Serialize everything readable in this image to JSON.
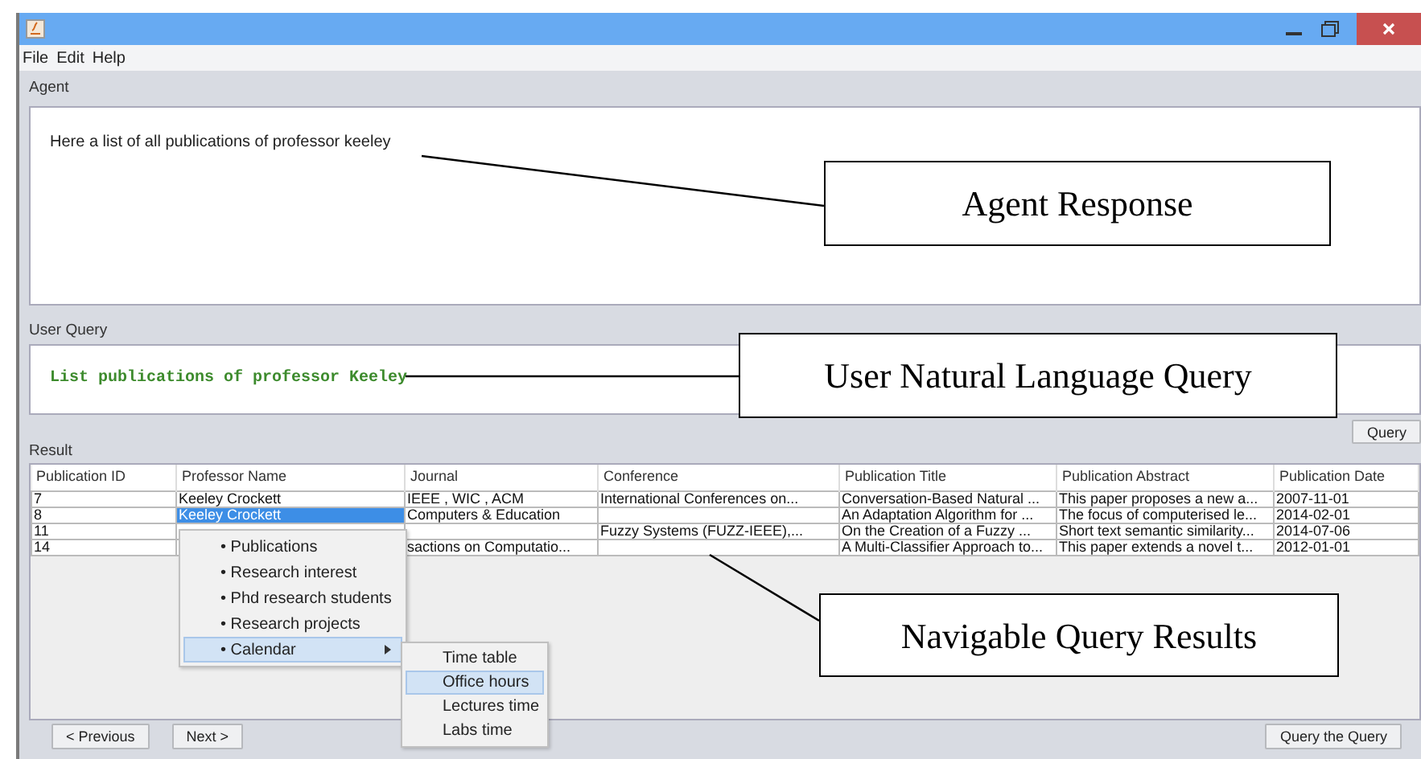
{
  "menu_bar": [
    "File",
    "Edit",
    "Help"
  ],
  "agent": {
    "label": "Agent",
    "text": "Here a list of all publications of professor keeley"
  },
  "user_query": {
    "label": "User Query",
    "text": "List publications of professor Keeley"
  },
  "query_button": "Query",
  "result": {
    "label": "Result",
    "columns": [
      "Publication ID",
      "Professor Name",
      "Journal",
      "Conference",
      "Publication Title",
      "Publication Abstract",
      "Publication Date"
    ],
    "rows": [
      {
        "cells": [
          "7",
          "Keeley Crockett",
          "IEEE , WIC , ACM",
          "International Conferences on...",
          "Conversation-Based Natural ...",
          "This paper proposes a new a...",
          "2007-11-01"
        ],
        "selected": false
      },
      {
        "cells": [
          "8",
          "Keeley Crockett",
          "Computers & Education",
          null,
          "An Adaptation Algorithm for ...",
          "The focus of computerised le...",
          "2014-02-01"
        ],
        "selected": true
      },
      {
        "cells": [
          "11",
          null,
          null,
          "Fuzzy Systems (FUZZ-IEEE),...",
          "On the Creation of a Fuzzy ...",
          "Short text semantic similarity...",
          "2014-07-06"
        ],
        "selected": false
      },
      {
        "cells": [
          "14",
          null,
          "sactions on Computatio...",
          null,
          "A Multi-Classifier Approach to...",
          "This paper extends a novel t...",
          "2012-01-01"
        ],
        "selected": false
      }
    ]
  },
  "context_menu": {
    "items": [
      {
        "label": "• Publications",
        "selected": false,
        "submenu": false
      },
      {
        "label": "• Research interest",
        "selected": false,
        "submenu": false
      },
      {
        "label": "• Phd research students",
        "selected": false,
        "submenu": false
      },
      {
        "label": "• Research projects",
        "selected": false,
        "submenu": false
      },
      {
        "label": "• Calendar",
        "selected": true,
        "submenu": true
      }
    ]
  },
  "submenu": {
    "items": [
      {
        "label": "Time table",
        "selected": false
      },
      {
        "label": "Office hours",
        "selected": true
      },
      {
        "label": "Lectures time",
        "selected": false
      },
      {
        "label": "Labs time",
        "selected": false
      }
    ]
  },
  "buttons": [
    "< Previous",
    "Next >",
    "Query the Query"
  ],
  "annotations": [
    {
      "text": "Agent Response"
    },
    {
      "text": "User Natural Language Query"
    },
    {
      "text": "Navigable Query Results"
    }
  ]
}
